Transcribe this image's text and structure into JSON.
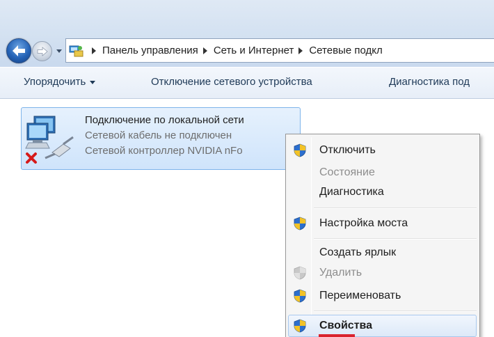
{
  "breadcrumb": {
    "items": [
      "Панель управления",
      "Сеть и Интернет",
      "Сетевые подкл"
    ]
  },
  "commandbar": {
    "organize_label": "Упорядочить",
    "disable_label": "Отключение сетевого устройства",
    "diagnostics_label": "Диагностика под"
  },
  "connection": {
    "name": "Подключение по локальной сети",
    "status": "Сетевой кабель не подключен",
    "device": "Сетевой контроллер NVIDIA nFo"
  },
  "context_menu": {
    "items": [
      {
        "label": "Отключить",
        "icon": "uac-shield-icon",
        "enabled": true
      },
      {
        "label": "Состояние",
        "icon": null,
        "enabled": false
      },
      {
        "label": "Диагностика",
        "icon": null,
        "enabled": true
      },
      {
        "label": "Настройка моста",
        "icon": "uac-shield-icon",
        "enabled": true
      },
      {
        "label": "Создать ярлык",
        "icon": null,
        "enabled": true
      },
      {
        "label": "Удалить",
        "icon": "uac-shield-icon",
        "enabled": false
      },
      {
        "label": "Переименовать",
        "icon": "uac-shield-icon",
        "enabled": true
      },
      {
        "label": "Свойства",
        "icon": "uac-shield-icon",
        "enabled": true,
        "highlighted": true,
        "default": true
      }
    ]
  },
  "colors": {
    "accent": "#2463b7",
    "selection": "#cfe4fb",
    "highlight_mark": "#d9232e"
  }
}
